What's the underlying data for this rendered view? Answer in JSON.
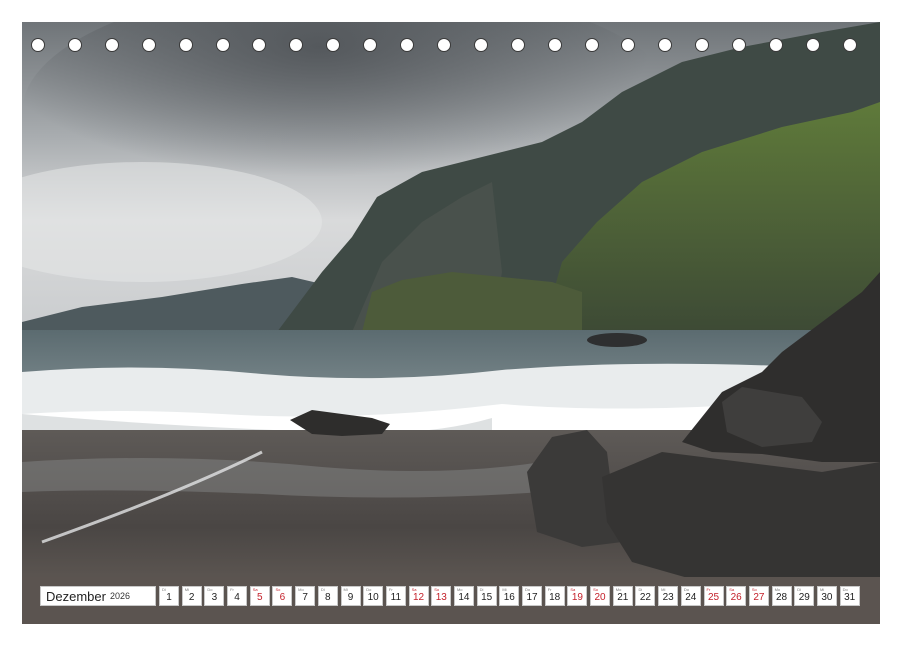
{
  "calendar": {
    "month": "Dezember",
    "year": "2026",
    "days": [
      {
        "num": "1",
        "abbr": "Di",
        "weekend": false
      },
      {
        "num": "2",
        "abbr": "Mi",
        "weekend": false
      },
      {
        "num": "3",
        "abbr": "Do",
        "weekend": false
      },
      {
        "num": "4",
        "abbr": "Fr",
        "weekend": false
      },
      {
        "num": "5",
        "abbr": "Sa",
        "weekend": true
      },
      {
        "num": "6",
        "abbr": "So",
        "weekend": true
      },
      {
        "num": "7",
        "abbr": "Mo",
        "weekend": false
      },
      {
        "num": "8",
        "abbr": "Di",
        "weekend": false
      },
      {
        "num": "9",
        "abbr": "Mi",
        "weekend": false
      },
      {
        "num": "10",
        "abbr": "Do",
        "weekend": false
      },
      {
        "num": "11",
        "abbr": "Fr",
        "weekend": false
      },
      {
        "num": "12",
        "abbr": "Sa",
        "weekend": true
      },
      {
        "num": "13",
        "abbr": "So",
        "weekend": true
      },
      {
        "num": "14",
        "abbr": "Mo",
        "weekend": false
      },
      {
        "num": "15",
        "abbr": "Di",
        "weekend": false
      },
      {
        "num": "16",
        "abbr": "Mi",
        "weekend": false
      },
      {
        "num": "17",
        "abbr": "Do",
        "weekend": false
      },
      {
        "num": "18",
        "abbr": "Fr",
        "weekend": false
      },
      {
        "num": "19",
        "abbr": "Sa",
        "weekend": true
      },
      {
        "num": "20",
        "abbr": "So",
        "weekend": true
      },
      {
        "num": "21",
        "abbr": "Mo",
        "weekend": false
      },
      {
        "num": "22",
        "abbr": "Di",
        "weekend": false
      },
      {
        "num": "23",
        "abbr": "Mi",
        "weekend": false
      },
      {
        "num": "24",
        "abbr": "Do",
        "weekend": false
      },
      {
        "num": "25",
        "abbr": "Fr",
        "weekend": true
      },
      {
        "num": "26",
        "abbr": "Sa",
        "weekend": true
      },
      {
        "num": "27",
        "abbr": "So",
        "weekend": true
      },
      {
        "num": "28",
        "abbr": "Mo",
        "weekend": false
      },
      {
        "num": "29",
        "abbr": "Di",
        "weekend": false
      },
      {
        "num": "30",
        "abbr": "Mi",
        "weekend": false
      },
      {
        "num": "31",
        "abbr": "Do",
        "weekend": false
      }
    ]
  },
  "ring_binding": {
    "hole_count": 23
  },
  "colors": {
    "weekend": "#c4202a",
    "weekday": "#222222",
    "border": "#c8c8c8"
  }
}
